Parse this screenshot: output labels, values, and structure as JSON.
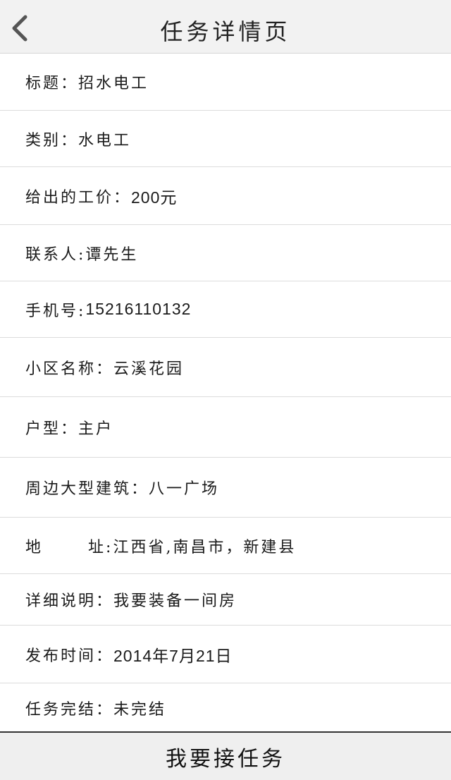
{
  "header": {
    "back_icon": "chevron-left-icon",
    "title": "任务详情页"
  },
  "details": {
    "title": {
      "label": "标题：",
      "value": "招水电工"
    },
    "category": {
      "label": "类别：",
      "value": "水电工"
    },
    "price": {
      "label": "给出的工价：",
      "value": "200元"
    },
    "contact": {
      "label": "联系人:",
      "value": "谭先生"
    },
    "phone": {
      "label": "手机号:",
      "value": "15216110132"
    },
    "community": {
      "label": "小区名称：",
      "value": "云溪花园"
    },
    "house_type": {
      "label": "户型：",
      "value": "主户"
    },
    "landmark": {
      "label": "周边大型建筑：",
      "value": "八一广场"
    },
    "address": {
      "label_first": "地",
      "label_second": "址:",
      "value": "江西省,南昌市，新建县"
    },
    "description": {
      "label": "详细说明：",
      "value": "我要装备一间房"
    },
    "publish_time": {
      "label": "发布时间：",
      "value": "2014年7月21日"
    },
    "status": {
      "label": "任务完结：",
      "value": "未完结"
    }
  },
  "footer": {
    "accept_label": "我要接任务"
  }
}
